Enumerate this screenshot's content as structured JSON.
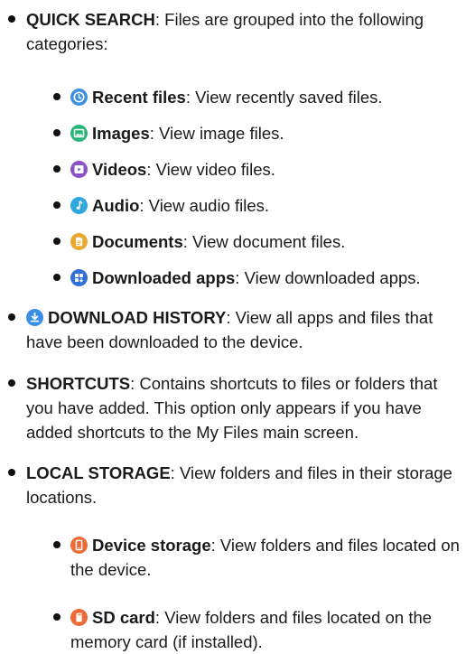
{
  "colors": {
    "recent": "#3d8fe0",
    "images": "#29b67a",
    "videos": "#8b52c8",
    "audio": "#2fa7e0",
    "documents": "#e9a832",
    "downloaded_apps": "#2f6fd6",
    "download_history": "#3a8ee6",
    "device_storage": "#ef6b36",
    "sd_card": "#ef6b36"
  },
  "quick_search": {
    "title": "QUICK SEARCH",
    "desc": ": Files are grouped into the following categories:",
    "items": [
      {
        "icon": "clock-icon",
        "title": "Recent files",
        "desc": ": View recently saved files."
      },
      {
        "icon": "image-icon",
        "title": "Images",
        "desc": ": View image files."
      },
      {
        "icon": "video-icon",
        "title": "Videos",
        "desc": ": View video files."
      },
      {
        "icon": "music-note-icon",
        "title": "Audio",
        "desc": ": View audio files."
      },
      {
        "icon": "document-icon",
        "title": "Documents",
        "desc": ": View document files."
      },
      {
        "icon": "apps-icon",
        "title": "Downloaded apps",
        "desc": ": View downloaded apps."
      }
    ]
  },
  "download_history": {
    "icon": "download-icon",
    "title": "DOWNLOAD HISTORY",
    "desc": ": View all apps and files that have been downloaded to the device."
  },
  "shortcuts": {
    "title": "SHORTCUTS",
    "desc": ": Contains shortcuts to files or folders that you have added. This option only appears if you have added shortcuts to the My Files main screen."
  },
  "local_storage": {
    "title": "LOCAL STORAGE",
    "desc": ": View folders and files in their storage locations.",
    "items": [
      {
        "icon": "phone-icon",
        "title": "Device storage",
        "desc": ": View folders and files located on the device."
      },
      {
        "icon": "sd-card-icon",
        "title": "SD card",
        "desc": ": View folders and files located on the memory card (if installed)."
      }
    ]
  }
}
